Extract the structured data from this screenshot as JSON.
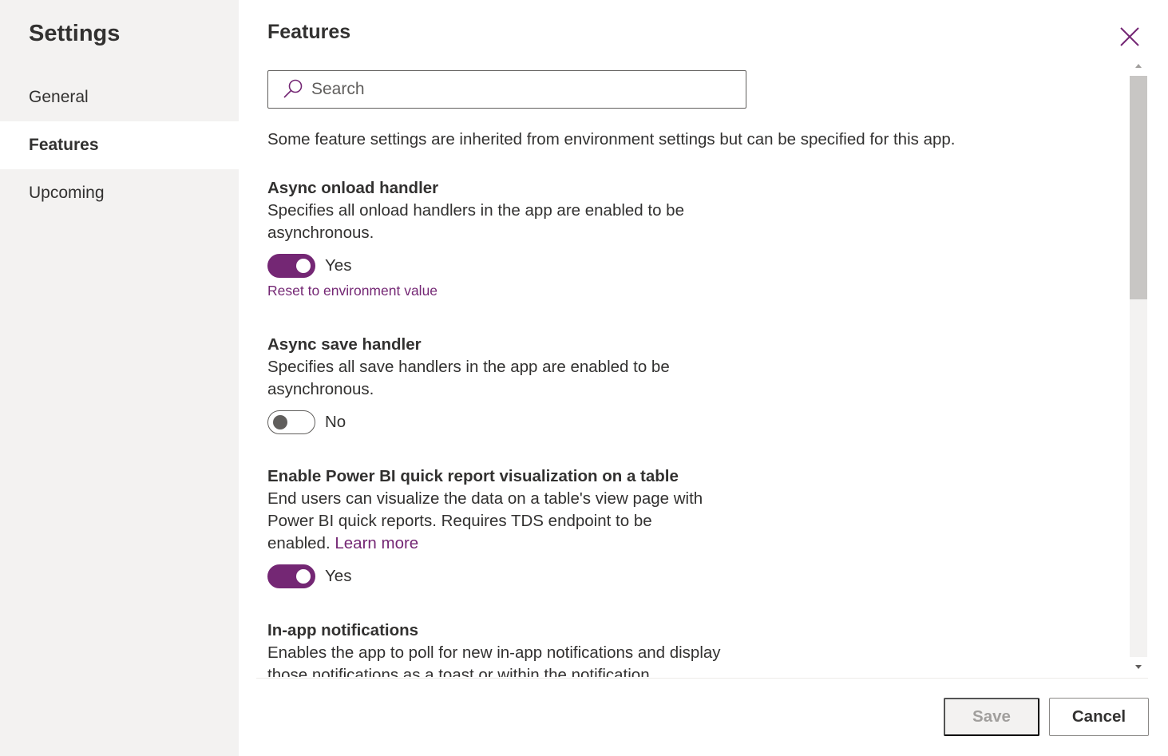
{
  "sidebar": {
    "title": "Settings",
    "items": [
      {
        "label": "General",
        "active": false
      },
      {
        "label": "Features",
        "active": true
      },
      {
        "label": "Upcoming",
        "active": false
      }
    ]
  },
  "panel": {
    "title": "Features",
    "search": {
      "placeholder": "Search",
      "value": ""
    },
    "intro": "Some feature settings are inherited from environment settings but can be specified for this app.",
    "features": [
      {
        "title": "Async onload handler",
        "description_line1": "Specifies all onload handlers in the app are enabled to be",
        "description_line2": "asynchronous.",
        "toggle_state": "on",
        "toggle_label": "Yes",
        "reset_link": "Reset to environment value"
      },
      {
        "title": "Async save handler",
        "description_line1": "Specifies all save handlers in the app are enabled to be",
        "description_line2": "asynchronous.",
        "toggle_state": "off",
        "toggle_label": "No"
      },
      {
        "title": "Enable Power BI quick report visualization on a table",
        "description_line1": "End users can visualize the data on a table's view page with",
        "description_line2": "Power BI quick reports. Requires TDS endpoint to be",
        "description_line3": "enabled.",
        "learn_more": "Learn more",
        "toggle_state": "on",
        "toggle_label": "Yes"
      },
      {
        "title": "In-app notifications",
        "description_line1": "Enables the app to poll for new in-app notifications and display",
        "description_line2": "those notifications as a toast or within the notification"
      }
    ]
  },
  "footer": {
    "save_label": "Save",
    "cancel_label": "Cancel"
  },
  "colors": {
    "accent": "#742774",
    "sidebar_bg": "#f3f2f1",
    "text": "#323130"
  },
  "icons": {
    "close": "close-icon",
    "search": "search-icon"
  }
}
